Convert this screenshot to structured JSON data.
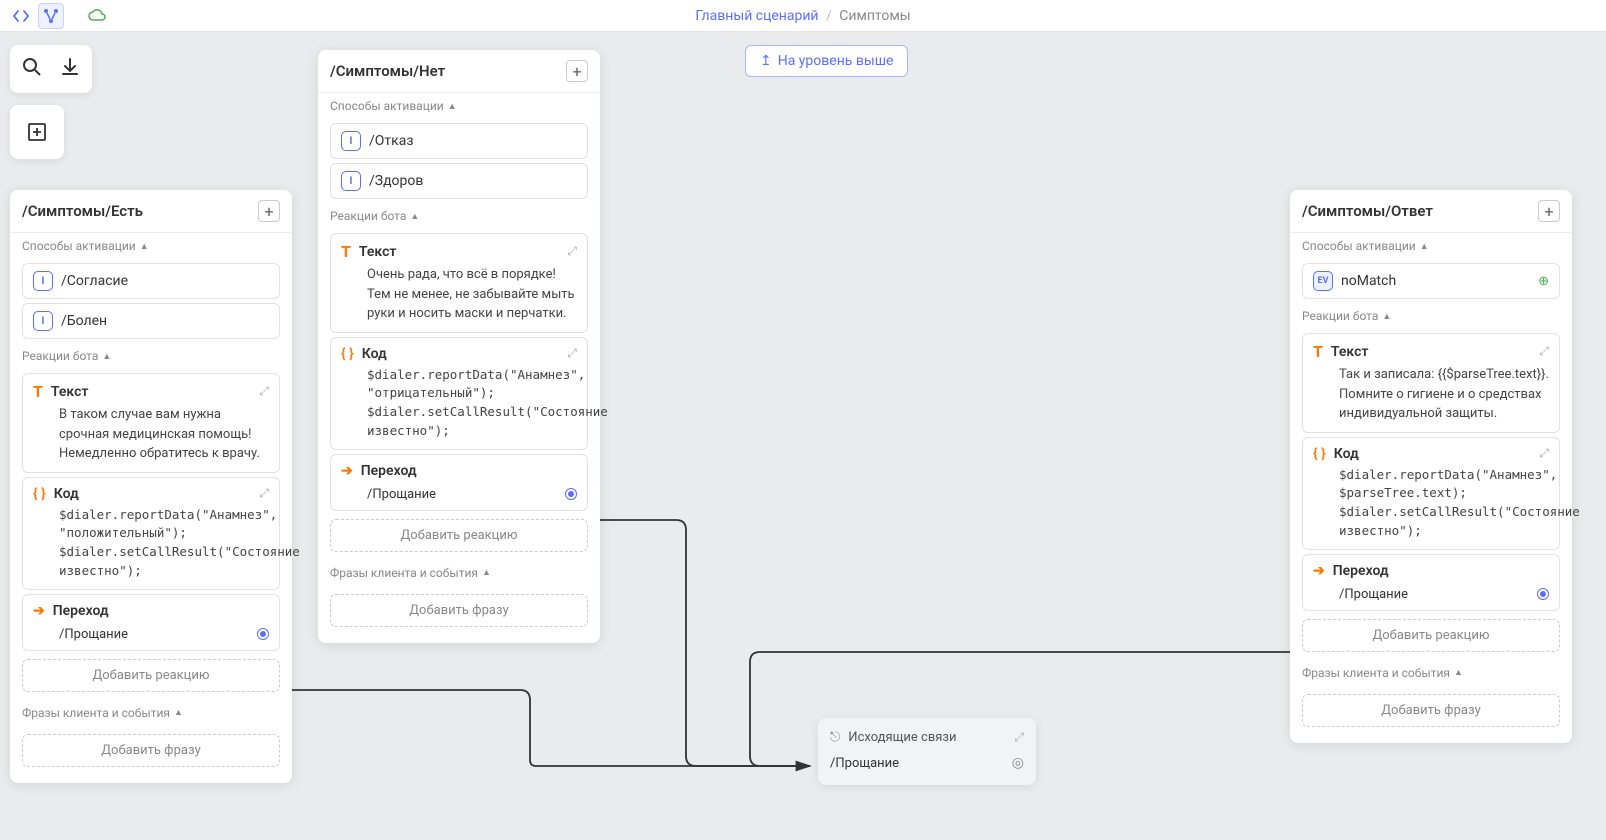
{
  "topbar": {
    "breadcrumb_main": "Главный сценарий",
    "breadcrumb_current": "Симптомы"
  },
  "up_level": {
    "label": "На уровень выше"
  },
  "labels": {
    "activation": "Способы активации",
    "reactions": "Реакции бота",
    "phrases": "Фразы клиента и события",
    "add_reaction": "Добавить реакцию",
    "add_phrase": "Добавить фразу",
    "text": "Текст",
    "code": "Код",
    "transition": "Переход"
  },
  "outgoing": {
    "title": "Исходящие связи",
    "target": "/Прощание"
  },
  "nodes": {
    "yes": {
      "title": "/Симптомы/Есть",
      "activations": [
        "/Согласие",
        "/Болен"
      ],
      "text_body": "В таком случае вам нужна срочная медицинская помощь! Немедленно обратитесь к врачу.",
      "code_body": "$dialer.reportData(\"Анамнез\", \"положительный\"); $dialer.setCallResult(\"Состояние известно\");",
      "transition": "/Прощание"
    },
    "no": {
      "title": "/Симптомы/Нет",
      "activations": [
        "/Отказ",
        "/Здоров"
      ],
      "text_body": "Очень рада, что всё в порядке! Тем не менее, не забывайте мыть руки и носить маски и перчатки.",
      "code_body": "$dialer.reportData(\"Анамнез\", \"отрицательный\"); $dialer.setCallResult(\"Состояние известно\");",
      "transition": "/Прощание"
    },
    "answer": {
      "title": "/Симптомы/Ответ",
      "activation_event": "noMatch",
      "text_body": "Так и записала: {{$parseTree.text}}. Помните о гигиене и о средствах индивидуальной защиты.",
      "code_body": "$dialer.reportData(\"Анамнез\", $parseTree.text); $dialer.setCallResult(\"Состояние известно\");",
      "transition": "/Прощание"
    }
  }
}
